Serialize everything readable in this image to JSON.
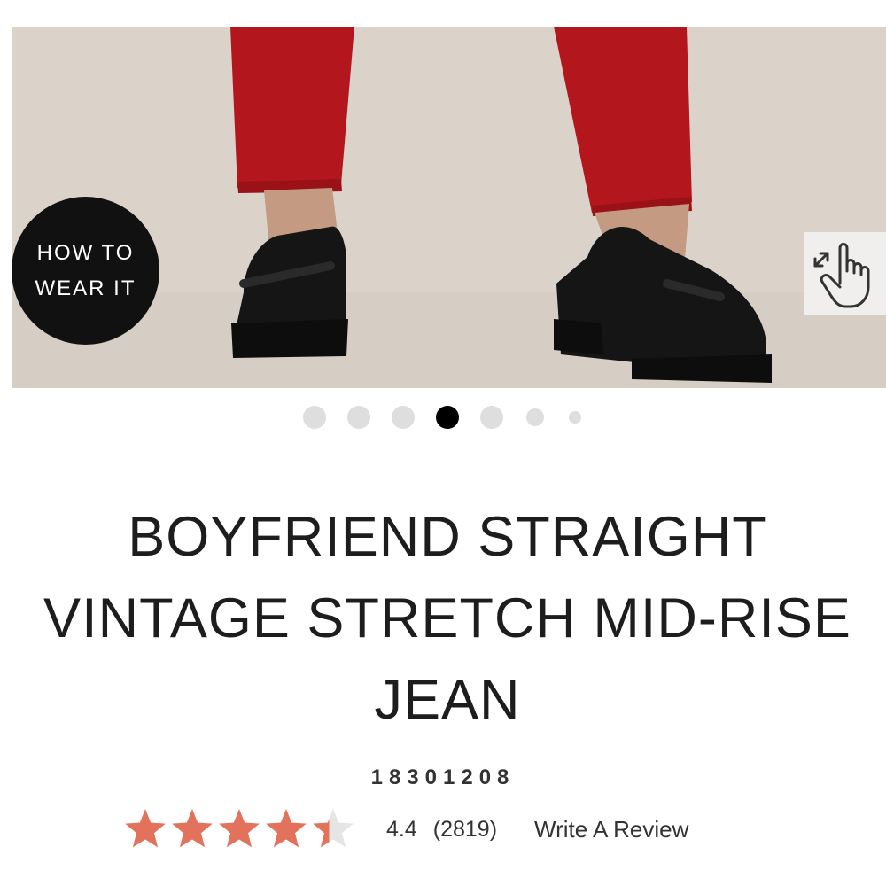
{
  "hero": {
    "how_to_wear_line1": "HOW TO",
    "how_to_wear_line2": "WEAR IT",
    "zoom_icon": "pinch-zoom-hand-icon"
  },
  "carousel": {
    "total_slides": 7,
    "active_slide": 4
  },
  "product": {
    "title": "BOYFRIEND STRAIGHT VINTAGE STRETCH MID-RISE JEAN",
    "sku": "18301208"
  },
  "rating": {
    "average": "4.4",
    "count": "(2819)",
    "write_review": "Write A Review",
    "star_value": 4.4,
    "star_max": 5,
    "star_color": "#e2725b",
    "star_empty_color": "#e5e5e5"
  },
  "colors": {
    "pants": "#b3161d",
    "shoe": "#151515",
    "background": "#d9d1c8"
  }
}
